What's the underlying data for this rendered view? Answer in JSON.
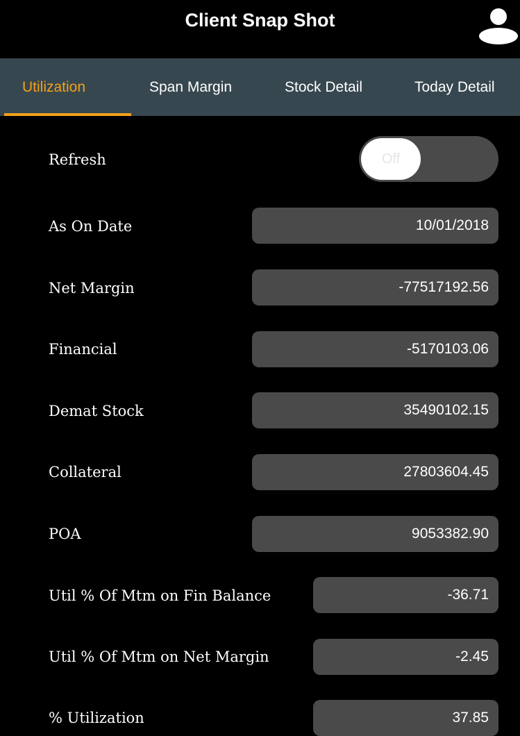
{
  "header": {
    "title": "Client Snap Shot",
    "icon": "user-icon"
  },
  "tabs": [
    {
      "label": "Utilization",
      "active": true
    },
    {
      "label": "Span Margin",
      "active": false
    },
    {
      "label": "Stock Detail",
      "active": false
    },
    {
      "label": "Today Detail",
      "active": false
    }
  ],
  "refresh": {
    "label": "Refresh",
    "toggle_text": "Off",
    "enabled": false
  },
  "rows": [
    {
      "label": "As On Date",
      "value": "10/01/2018"
    },
    {
      "label": "Net Margin",
      "value": "-77517192.56"
    },
    {
      "label": "Financial",
      "value": "-5170103.06"
    },
    {
      "label": "Demat Stock",
      "value": "35490102.15"
    },
    {
      "label": "Collateral",
      "value": "27803604.45"
    },
    {
      "label": "POA",
      "value": "9053382.90"
    },
    {
      "label": "Util % Of Mtm on Fin Balance",
      "value": "-36.71"
    },
    {
      "label": "Util % Of Mtm on Net Margin",
      "value": "-2.45"
    },
    {
      "label": "% Utilization",
      "value": "37.85"
    }
  ],
  "colors": {
    "accent": "#f4a11a",
    "tabbar": "#37474f",
    "field": "#4a4a4a",
    "background": "#000000"
  }
}
